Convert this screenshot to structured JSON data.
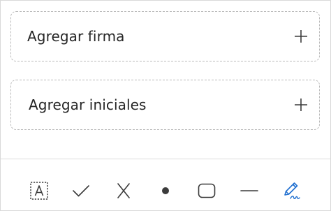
{
  "signature_panel": {
    "add_signature_label": "Agregar firma",
    "add_initials_label": "Agregar iniciales"
  },
  "toolbar": {
    "tools": [
      {
        "name": "add-text",
        "icon": "text-box-icon"
      },
      {
        "name": "checkmark",
        "icon": "checkmark-icon"
      },
      {
        "name": "cross",
        "icon": "cross-icon"
      },
      {
        "name": "dot",
        "icon": "dot-icon"
      },
      {
        "name": "rectangle",
        "icon": "rounded-rectangle-icon"
      },
      {
        "name": "line",
        "icon": "line-icon"
      },
      {
        "name": "sign",
        "icon": "pen-signature-icon",
        "active": true
      }
    ]
  },
  "colors": {
    "text": "#262626",
    "icon": "#3b3b3b",
    "accent": "#1f6fd0",
    "dashed_border": "#b9b9b9"
  }
}
